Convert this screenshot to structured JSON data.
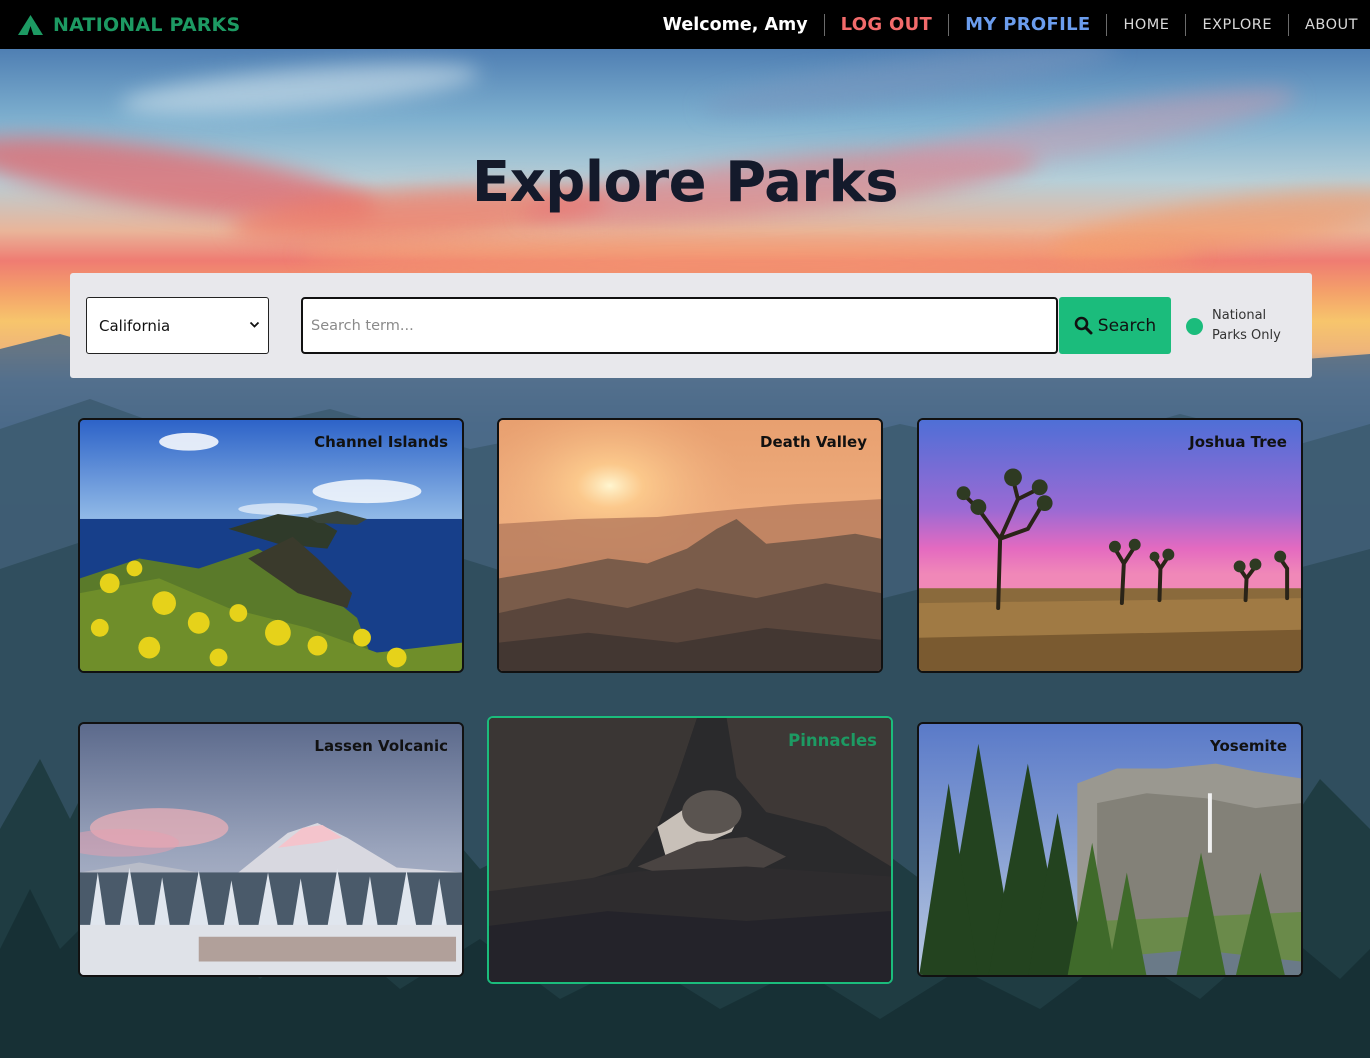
{
  "nav": {
    "brand": "NATIONAL PARKS",
    "welcome": "Welcome, Amy",
    "logout": "LOG OUT",
    "profile": "MY PROFILE",
    "home": "HOME",
    "explore": "EXPLORE",
    "about": "ABOUT"
  },
  "hero": {
    "title": "Explore Parks"
  },
  "search": {
    "state_value": "California",
    "placeholder": "Search term...",
    "button_label": "Search",
    "np_only_label": "National Parks Only"
  },
  "parks": [
    {
      "name": "Channel Islands"
    },
    {
      "name": "Death Valley"
    },
    {
      "name": "Joshua Tree"
    },
    {
      "name": "Lassen Volcanic"
    },
    {
      "name": "Pinnacles"
    },
    {
      "name": "Yosemite"
    }
  ],
  "colors": {
    "brand_green": "#1d9a63",
    "accent_green": "#1bbc7c",
    "logout_red": "#f26b6b",
    "profile_blue": "#6b9dee"
  },
  "icons": [
    "mountain-logo-icon",
    "chevron-down-icon",
    "search-icon",
    "toggle-dot-icon"
  ]
}
